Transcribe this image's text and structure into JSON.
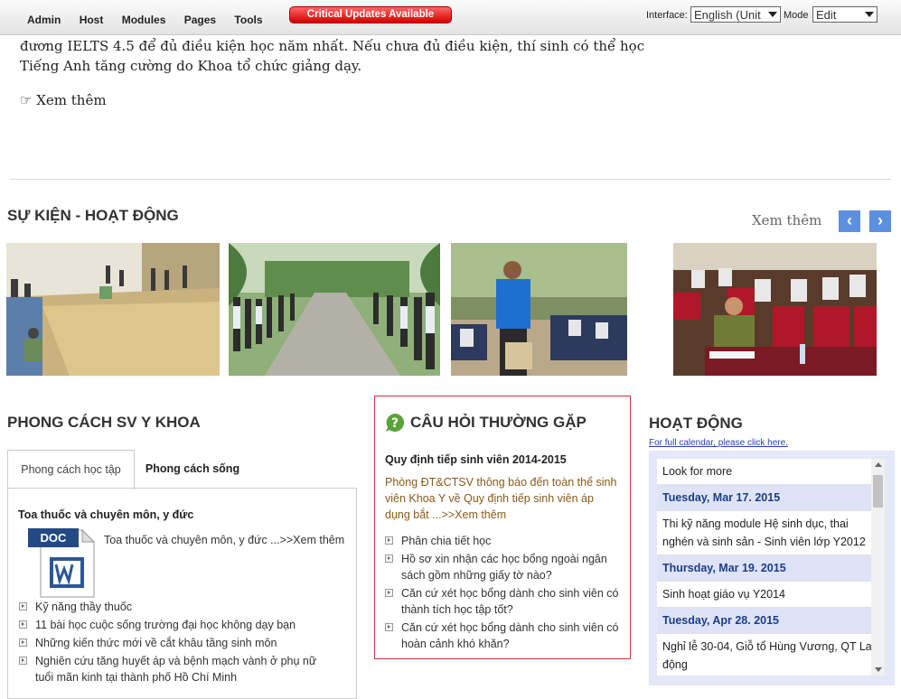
{
  "control_bar": {
    "menu": [
      "Admin",
      "Host",
      "Modules",
      "Pages",
      "Tools"
    ],
    "critical_updates": "Critical Updates Available",
    "interface_label": "Interface:",
    "interface_value": "English (Unit",
    "mode_label": "Mode",
    "mode_value": "Edit"
  },
  "intro": {
    "line1": "đương IELTS 4.5 để đủ điều kiện học năm nhất. Nếu chưa đủ điều kiện, thí sinh có thể học",
    "line2": "Tiếng Anh tăng cường do Khoa tổ chức giảng dạy.",
    "more": "☞ Xem thêm"
  },
  "events": {
    "title": "SỰ KIỆN - HOẠT ĐỘNG",
    "more": "Xem thêm",
    "prev_icon": "‹",
    "next_icon": "›"
  },
  "lifestyle": {
    "title": "PHONG CÁCH SV Y KHOA",
    "tabs": [
      "Phong cách học tập",
      "Phong cách sống"
    ],
    "article_title": "Toa thuốc và chuyên môn, y đức",
    "doc_badge": "DOC",
    "article_summary": "Toa thuốc và chuyên môn, y đức ...>>Xem thêm",
    "items": [
      "Kỹ năng thầy thuốc",
      "11 bài học cuộc sống trường đại học không dạy bạn",
      "Những kiến thức mới về cắt khâu tầng sinh môn",
      "Nghiên cứu tăng huyết áp và bệnh mạch vành ở phụ nữ tuổi mãn kinh tại thành phố Hồ Chí Minh"
    ]
  },
  "faq": {
    "title": "CÂU HỎI THƯỜNG GẶP",
    "article_title": "Quy định tiếp sinh viên 2014-2015",
    "summary": "Phòng ĐT&CTSV thông báo đến toàn thể sinh viên Khoa Y về Quy định tiếp sinh viên áp dụng bắt ...>>Xem thêm",
    "items": [
      "Phân chia tiết học",
      "Hồ sơ xin nhận các học bổng ngoài ngân sách gồm những giấy tờ nào?",
      "Căn cứ xét học bổng dành cho sinh viên có thành tích học tập tốt?",
      "Căn cứ xét học bổng dành cho sinh viên có hoàn cảnh khó khăn?"
    ]
  },
  "activities": {
    "title": "HOẠT ĐỘNG",
    "calendar_link": "For full calendar, please click here.",
    "rows": [
      {
        "type": "item",
        "text": "Look for more"
      },
      {
        "type": "date",
        "text": "Tuesday, Mar 17. 2015"
      },
      {
        "type": "item",
        "text": "Thi kỹ năng module Hệ sinh dục, thai nghén và sinh sản - Sinh viên lớp Y2012"
      },
      {
        "type": "date",
        "text": "Thursday, Mar 19. 2015"
      },
      {
        "type": "item",
        "text": "Sinh hoạt giáo vụ Y2014"
      },
      {
        "type": "date",
        "text": "Tuesday, Apr 28. 2015"
      },
      {
        "type": "item",
        "text": "Nghỉ lễ 30-04, Giỗ tổ Hùng Vương, QT Lao động"
      }
    ]
  }
}
